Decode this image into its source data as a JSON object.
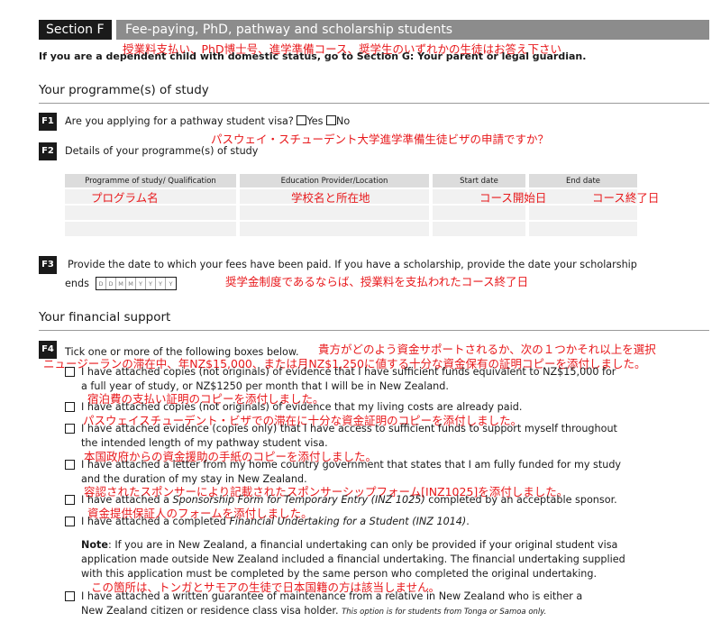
{
  "section": {
    "label": "Section F",
    "title": "Fee-paying, PhD, pathway and scholarship students",
    "title_jp": "授業料支払い、PhD博士号、進学準備コース、奨学生のいずれかの生徒はお答え下さい",
    "dependent_note": "If you are a dependent child with domestic status, go to Section G: Your parent or legal guardian."
  },
  "programme": {
    "heading": "Your programme(s) of study",
    "f1": {
      "num": "F1",
      "question": "Are you applying for a pathway student visa?",
      "yes": "Yes",
      "no": "No",
      "jp": "パスウェイ・スチューデント大学進学準備生徒ビザの申請ですか？"
    },
    "f2": {
      "num": "F2",
      "question": "Details of your programme(s) of study",
      "columns": [
        "Programme of study/ Qualification",
        "Education Provider/Location",
        "Start date",
        "End date"
      ],
      "columns_jp": [
        "プログラム名",
        "学校名と所在地",
        "コース開始日",
        "コース終了日"
      ]
    },
    "f3": {
      "num": "F3",
      "question": "Provide the date to which your fees have been paid. If you have a scholarship, provide the date your scholarship",
      "ends": "ends",
      "date_cells": [
        "D",
        "D",
        "M",
        "M",
        "Y",
        "Y",
        "Y",
        "Y"
      ],
      "jp": "奨学金制度であるならば、授業料を支払われたコース終了日"
    }
  },
  "financial": {
    "heading": "Your financial support",
    "f4": {
      "num": "F4",
      "question": "Tick one or more of the following boxes below.",
      "jp_intro": "貴方がどのよう資金サポートされるか、次の１つかそれ以上を選択",
      "jp_intro2": "ニュージーランの滞在中、年NZ$15,000、または月NZ$1,250に値する十分な資金保有の証明コピーを添付しました。",
      "opt1_l1": "I have attached copies (not originals) of evidence that I have sufficient funds equivalent to NZ$15,000 for",
      "opt1_l2": "a full year of study, or NZ$1250 per month that I will be in New Zealand.",
      "opt1_jp": "宿泊費の支払い証明のコピーを添付しました。",
      "opt2": "I have attached copies (not originals) of evidence that my living costs are already paid.",
      "opt2_jp": "パスウェイスチューデント・ビザでの滞在に十分な資金証明のコピーを添付しました。",
      "opt3_l1": "I have attached evidence (copies only) that I have access to sufficient funds to support myself throughout",
      "opt3_l2": "the intended length of my pathway student visa.",
      "opt3_jp": "本国政府からの資金援助の手紙のコピーを添付しました。",
      "opt4_l1": "I have attached a letter from my home country government that states that I am fully funded for my study",
      "opt4_l2": "and the duration of my stay in New Zealand.",
      "opt4_jp": "容認されたスポンサーにより記載されたスポンサーシップフォーム[INZ1025]を添付しました。",
      "opt5_a": "I have attached a ",
      "opt5_b": "Sponsorship Form for Temporary Entry (INZ 1025)",
      "opt5_c": " completed by an acceptable sponsor.",
      "opt5_jp": "資金提供保証人のフォームを添付しました。",
      "opt6_a": "I have attached a completed ",
      "opt6_b": "Financial Undertaking for a Student (INZ 1014)",
      "opt6_c": ".",
      "note_label": "Note",
      "note_l1": ": If you are in New Zealand, a financial undertaking can only be provided if your original student visa",
      "note_l2": "application made outside New Zealand included a financial undertaking. The financial undertaking supplied",
      "note_l3": "with this application must be completed by the same person who completed the original undertaking.",
      "note_jp": "この箇所は、トンガとサモアの生徒で日本国籍の方は該当しません。",
      "opt7_l1": "I have attached a written guarantee of maintenance from a relative in New Zealand who is either a",
      "opt7_l2": "New Zealand citizen or residence class visa holder.",
      "opt7_small": "This option is for students from Tonga or Samoa only."
    }
  }
}
